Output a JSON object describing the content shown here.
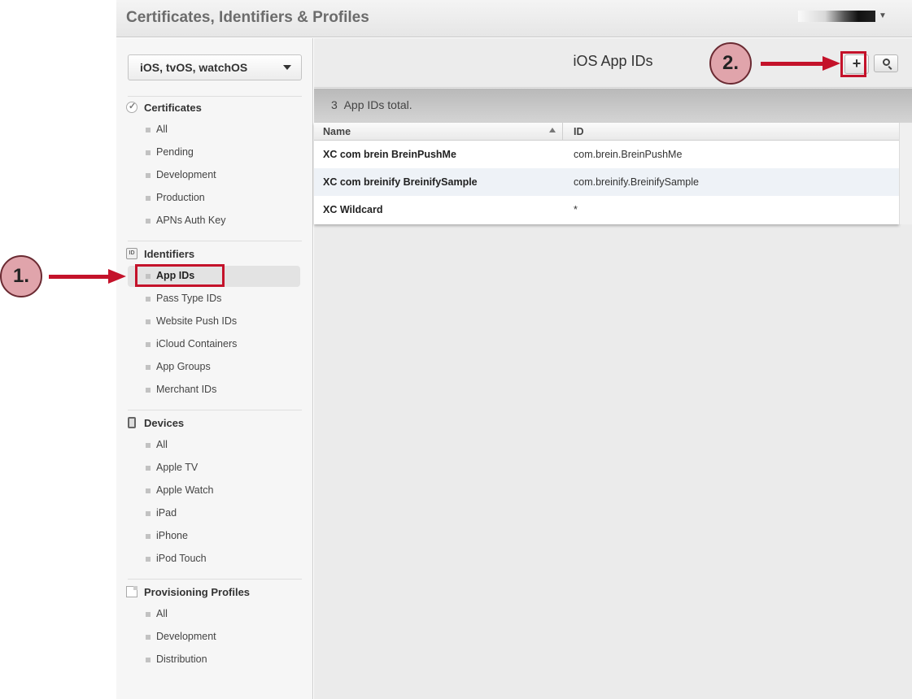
{
  "header": {
    "title": "Certificates, Identifiers & Profiles"
  },
  "sidebar": {
    "platform": "iOS, tvOS, watchOS",
    "sections": [
      {
        "title": "Certificates",
        "icon": "certificate-icon",
        "items": [
          "All",
          "Pending",
          "Development",
          "Production",
          "APNs Auth Key"
        ]
      },
      {
        "title": "Identifiers",
        "icon": "id-icon",
        "items": [
          "App IDs",
          "Pass Type IDs",
          "Website Push IDs",
          "iCloud Containers",
          "App Groups",
          "Merchant IDs"
        ]
      },
      {
        "title": "Devices",
        "icon": "device-icon",
        "items": [
          "All",
          "Apple TV",
          "Apple Watch",
          "iPad",
          "iPhone",
          "iPod Touch"
        ]
      },
      {
        "title": "Provisioning Profiles",
        "icon": "profile-icon",
        "items": [
          "All",
          "Development",
          "Distribution"
        ]
      }
    ],
    "selected": "App IDs"
  },
  "main": {
    "title": "iOS App IDs",
    "add_label": "+",
    "count_number": "3",
    "count_text": "App IDs total.",
    "columns": {
      "name": "Name",
      "id": "ID"
    },
    "rows": [
      {
        "name": "XC com brein BreinPushMe",
        "id": "com.brein.BreinPushMe"
      },
      {
        "name": "XC com breinify BreinifySample",
        "id": "com.breinify.BreinifySample"
      },
      {
        "name": "XC Wildcard",
        "id": "*"
      }
    ]
  },
  "annotations": {
    "step1": "1.",
    "step2": "2."
  },
  "colors": {
    "highlight": "#c4122a",
    "marker_fill": "#e0a4ab"
  }
}
